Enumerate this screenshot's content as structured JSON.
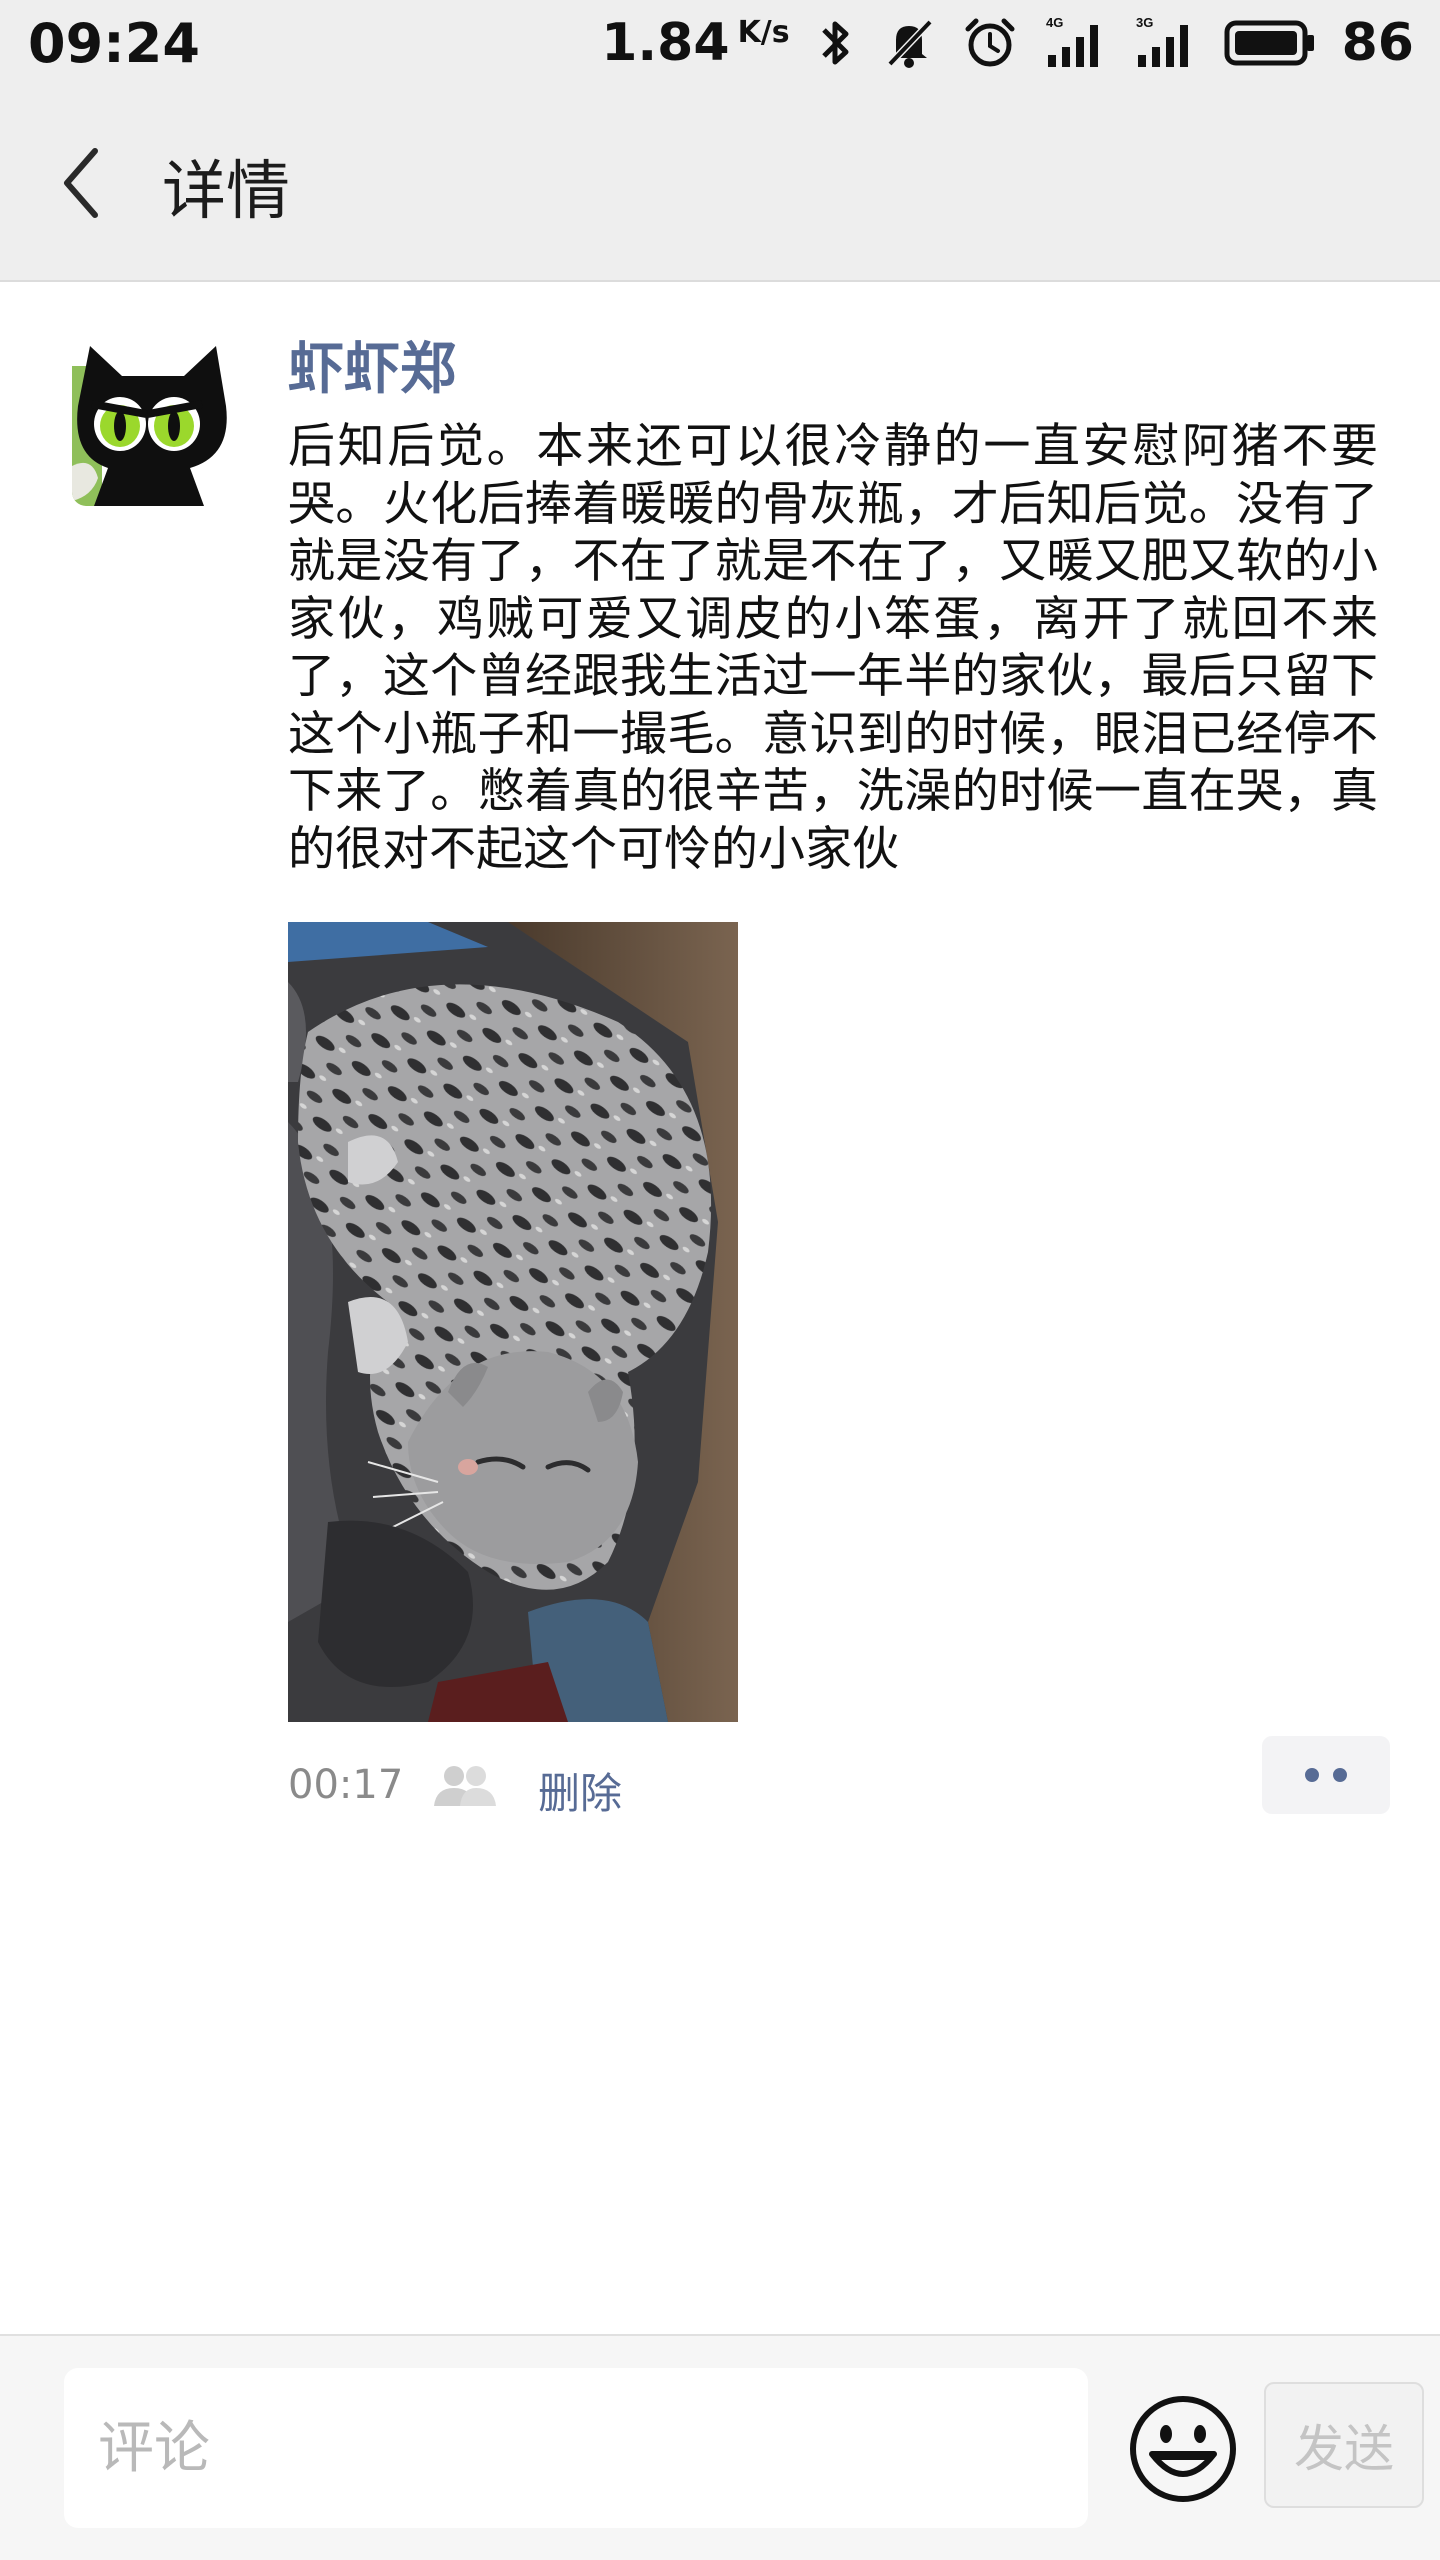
{
  "status_bar": {
    "time": "09:24",
    "net_speed": "1.84",
    "net_speed_unit": "K/s",
    "battery_percent": "86",
    "icons": [
      "bluetooth-icon",
      "notifications-muted-icon",
      "alarm-icon",
      "signal-4g-icon",
      "signal-3g-icon",
      "battery-icon"
    ]
  },
  "header": {
    "title": "详情",
    "back_icon": "chevron-left-icon"
  },
  "post": {
    "author": "虾虾郑",
    "avatar_icon": "black-cat-avatar",
    "text": "后知后觉。本来还可以很冷静的一直安慰阿猪不要哭。火化后捧着暖暖的骨灰瓶，才后知后觉。没有了就是没有了，不在了就是不在了，又暖又肥又软的小家伙，鸡贼可爱又调皮的小笨蛋，离开了就回不来了，这个曾经跟我生活过一年半的家伙，最后只留下这个小瓶子和一撮毛。意识到的时候，眼泪已经停不下来了。憋着真的很辛苦，洗澡的时候一直在哭，真的很对不起这个可怜的小家伙",
    "photo_icon": "sleeping-tabby-cat-photo",
    "time": "00:17",
    "visibility_icon": "people-icon",
    "delete_label": "删除",
    "more_icon": "more-dots-icon"
  },
  "comment_bar": {
    "placeholder": "评论",
    "emoji_icon": "smiley-icon",
    "send_label": "发送"
  }
}
